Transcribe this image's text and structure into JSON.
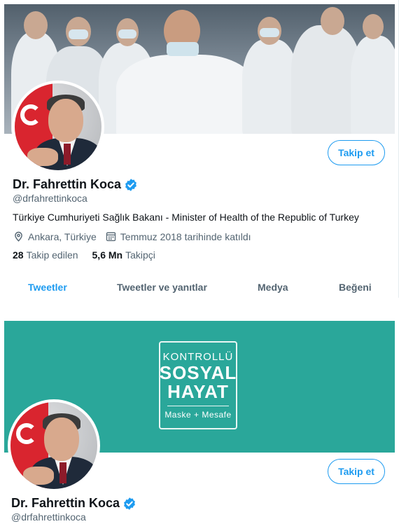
{
  "profile_top": {
    "name": "Dr. Fahrettin Koca",
    "handle": "@drfahrettinkoca",
    "follow_label": "Takip et",
    "bio": "Türkiye Cumhuriyeti Sağlık Bakanı - Minister of Health of the Republic of Turkey",
    "location": "Ankara, Türkiye",
    "joined": "Temmuz 2018 tarihinde katıldı",
    "following_count": "28",
    "following_label": "Takip edilen",
    "followers_count": "5,6 Mn",
    "followers_label": "Takipçi",
    "tabs": [
      {
        "label": "Tweetler",
        "active": true
      },
      {
        "label": "Tweetler ve yanıtlar",
        "active": false
      },
      {
        "label": "Medya",
        "active": false
      },
      {
        "label": "Beğeni",
        "active": false
      }
    ]
  },
  "profile_bottom": {
    "banner_logo": {
      "line1": "KONTROLLÜ",
      "line2": "SOSYAL",
      "line3": "HAYAT",
      "line4": "Maske + Mesafe"
    },
    "name": "Dr. Fahrettin Koca",
    "handle": "@drfahrettinkoca",
    "follow_label": "Takip et"
  },
  "icons": [
    "verified-badge-icon",
    "location-pin-icon",
    "calendar-icon"
  ],
  "colors": {
    "accent": "#1d9bf0",
    "banner_teal": "#2aa79a",
    "secondary_text": "#536471"
  }
}
